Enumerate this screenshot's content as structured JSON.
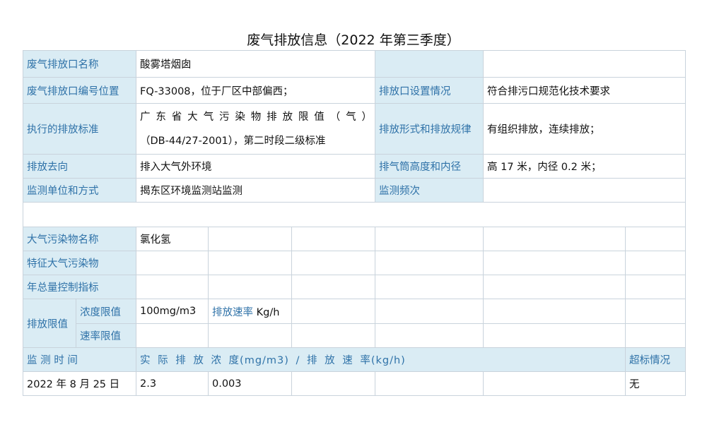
{
  "title": "废气排放信息（2022 年第三季度）",
  "info": {
    "outlet_name_label": "废气排放口名称",
    "outlet_name": "酸雾塔烟囱",
    "outlet_code_label": "废气排放口编号位置",
    "outlet_code": "FQ-33008，位于厂区中部偏西；",
    "outlet_setup_label": "排放口设置情况",
    "outlet_setup": "符合排污口规范化技术要求",
    "standard_label": "执行的排放标准",
    "standard_line1_chars": [
      "广",
      "东",
      "省",
      "大",
      "气",
      "污",
      "染",
      "物",
      "排",
      "放",
      "限",
      "值",
      "（",
      "气",
      "）"
    ],
    "standard_line2": "（DB-44/27-2001），第二时段二级标准",
    "form_label": "排放形式和排放规律",
    "form": "有组织排放，连续排放；",
    "direction_label": "排放去向",
    "direction": "排入大气外环境",
    "stack_label": "排气筒高度和内径",
    "stack": "高 17 米，内径 0.2 米；",
    "monitor_unit_label": "监测单位和方式",
    "monitor_unit": "揭东区环境监测站监测",
    "frequency_label": "监测频次",
    "frequency": ""
  },
  "pollutants": {
    "name_label": "大气污染物名称",
    "name": "氯化氢",
    "feature_label": "特征大气污染物",
    "total_label": "年总量控制指标",
    "limit_label": "排放限值",
    "conc_limit_label": "浓度限值",
    "conc_limit": "100mg/m3",
    "rate_label": "排放速率",
    "rate_unit": "Kg/h",
    "rate_limit_label": "速率限值"
  },
  "monitoring": {
    "time_label": "监 测 时 间",
    "conc_header": "实 际 排 放 浓 度(mg/m3) / 排 放 速 率(kg/h)",
    "exceed_label": "超标情况",
    "rows": [
      {
        "date": "2022 年 8 月 25 日",
        "conc": "2.3",
        "rate": "0.003",
        "exceed": "无"
      }
    ]
  }
}
